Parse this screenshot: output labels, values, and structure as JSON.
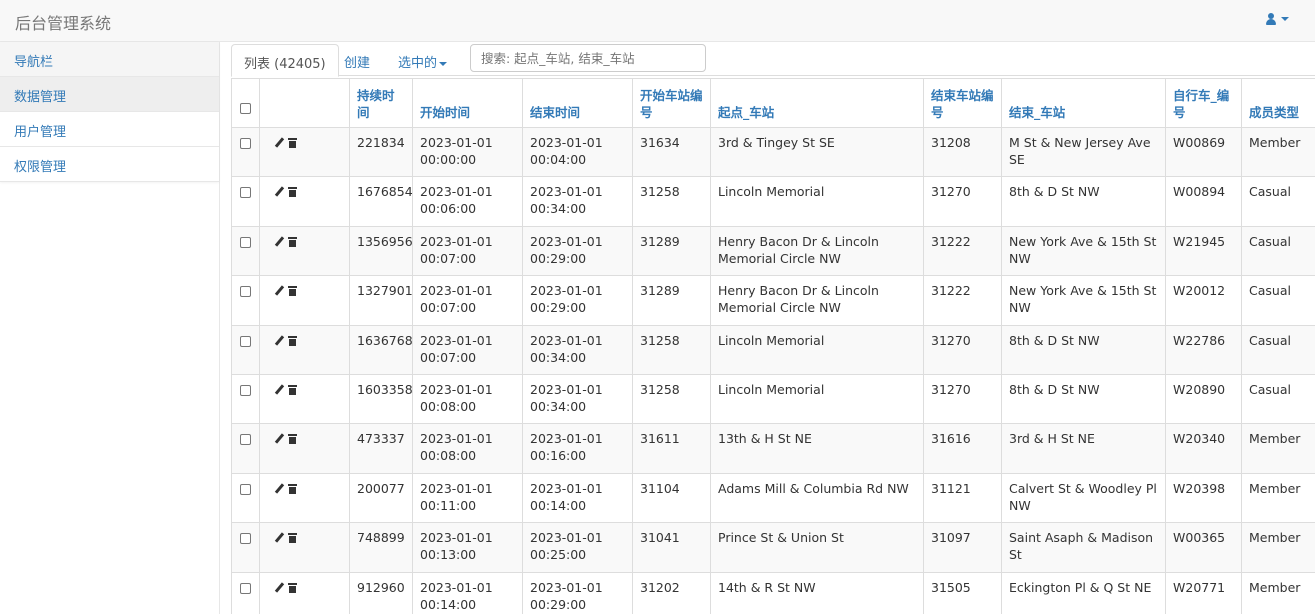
{
  "app": {
    "title": "后台管理系统"
  },
  "sidebar": {
    "items": [
      {
        "label": "导航栏"
      },
      {
        "label": "数据管理"
      },
      {
        "label": "用户管理"
      },
      {
        "label": "权限管理"
      }
    ]
  },
  "tabs": {
    "list_label": "列表 (42405)",
    "create_label": "创建",
    "selected_label": "选中的"
  },
  "search": {
    "placeholder": "搜索: 起点_车站, 结束_车站"
  },
  "table": {
    "headers": [
      "持续时间",
      "开始时间",
      "结束时间",
      "开始车站编号",
      "起点_车站",
      "结束车站编号",
      "结束_车站",
      "自行车_编号",
      "成员类型"
    ],
    "rows": [
      {
        "duration": "221834",
        "start": "2023-01-01 00:00:00",
        "end": "2023-01-01 00:04:00",
        "start_id": "31634",
        "start_station": "3rd & Tingey St SE",
        "end_id": "31208",
        "end_station": "M St & New Jersey Ave SE",
        "bike": "W00869",
        "member": "Member"
      },
      {
        "duration": "1676854",
        "start": "2023-01-01 00:06:00",
        "end": "2023-01-01 00:34:00",
        "start_id": "31258",
        "start_station": "Lincoln Memorial",
        "end_id": "31270",
        "end_station": "8th & D St NW",
        "bike": "W00894",
        "member": "Casual"
      },
      {
        "duration": "1356956",
        "start": "2023-01-01 00:07:00",
        "end": "2023-01-01 00:29:00",
        "start_id": "31289",
        "start_station": "Henry Bacon Dr & Lincoln Memorial Circle NW",
        "end_id": "31222",
        "end_station": "New York Ave & 15th St NW",
        "bike": "W21945",
        "member": "Casual"
      },
      {
        "duration": "1327901",
        "start": "2023-01-01 00:07:00",
        "end": "2023-01-01 00:29:00",
        "start_id": "31289",
        "start_station": "Henry Bacon Dr & Lincoln Memorial Circle NW",
        "end_id": "31222",
        "end_station": "New York Ave & 15th St NW",
        "bike": "W20012",
        "member": "Casual"
      },
      {
        "duration": "1636768",
        "start": "2023-01-01 00:07:00",
        "end": "2023-01-01 00:34:00",
        "start_id": "31258",
        "start_station": "Lincoln Memorial",
        "end_id": "31270",
        "end_station": "8th & D St NW",
        "bike": "W22786",
        "member": "Casual"
      },
      {
        "duration": "1603358",
        "start": "2023-01-01 00:08:00",
        "end": "2023-01-01 00:34:00",
        "start_id": "31258",
        "start_station": "Lincoln Memorial",
        "end_id": "31270",
        "end_station": "8th & D St NW",
        "bike": "W20890",
        "member": "Casual"
      },
      {
        "duration": "473337",
        "start": "2023-01-01 00:08:00",
        "end": "2023-01-01 00:16:00",
        "start_id": "31611",
        "start_station": "13th & H St NE",
        "end_id": "31616",
        "end_station": "3rd & H St NE",
        "bike": "W20340",
        "member": "Member"
      },
      {
        "duration": "200077",
        "start": "2023-01-01 00:11:00",
        "end": "2023-01-01 00:14:00",
        "start_id": "31104",
        "start_station": "Adams Mill & Columbia Rd NW",
        "end_id": "31121",
        "end_station": "Calvert St & Woodley Pl NW",
        "bike": "W20398",
        "member": "Member"
      },
      {
        "duration": "748899",
        "start": "2023-01-01 00:13:00",
        "end": "2023-01-01 00:25:00",
        "start_id": "31041",
        "start_station": "Prince St & Union St",
        "end_id": "31097",
        "end_station": "Saint Asaph & Madison St",
        "bike": "W00365",
        "member": "Member"
      },
      {
        "duration": "912960",
        "start": "2023-01-01 00:14:00",
        "end": "2023-01-01 00:29:00",
        "start_id": "31202",
        "start_station": "14th & R St NW",
        "end_id": "31505",
        "end_station": "Eckington Pl & Q St NE",
        "bike": "W20771",
        "member": "Member"
      }
    ]
  }
}
